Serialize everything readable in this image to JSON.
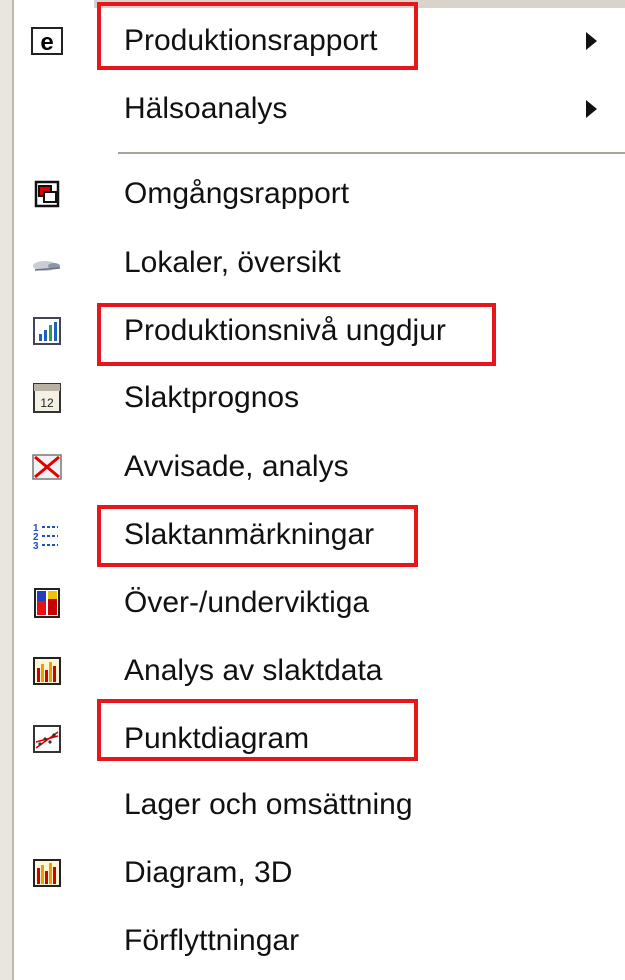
{
  "menu": {
    "items": [
      {
        "label": "Produktionsrapport",
        "icon": "e-logo-icon",
        "submenu": true
      },
      {
        "label": "Hälsoanalys",
        "icon": "",
        "submenu": true
      },
      {
        "label": "Omgångsrapport",
        "icon": "windows-icon",
        "submenu": false
      },
      {
        "label": "Lokaler, översikt",
        "icon": "pig-icon",
        "submenu": false
      },
      {
        "label": "Produktionsnivå ungdjur",
        "icon": "bar-chart-icon",
        "submenu": false
      },
      {
        "label": "Slaktprognos",
        "icon": "calendar-icon",
        "submenu": false
      },
      {
        "label": "Avvisade, analys",
        "icon": "cross-icon",
        "submenu": false
      },
      {
        "label": "Slaktanmärkningar",
        "icon": "numbered-list-icon",
        "submenu": false
      },
      {
        "label": "Över-/underviktiga",
        "icon": "stacked-bar-icon",
        "submenu": false
      },
      {
        "label": "Analys av slaktdata",
        "icon": "column-chart-icon",
        "submenu": false
      },
      {
        "label": "Punktdiagram",
        "icon": "scatter-chart-icon",
        "submenu": false
      },
      {
        "label": "Lager och omsättning",
        "icon": "",
        "submenu": false
      },
      {
        "label": "Diagram, 3D",
        "icon": "column-chart-3d-icon",
        "submenu": false
      },
      {
        "label": "Förflyttningar",
        "icon": "",
        "submenu": false
      }
    ]
  },
  "colors": {
    "highlight": "#e8161b",
    "text": "#111111",
    "gutter": "#ffffff"
  }
}
